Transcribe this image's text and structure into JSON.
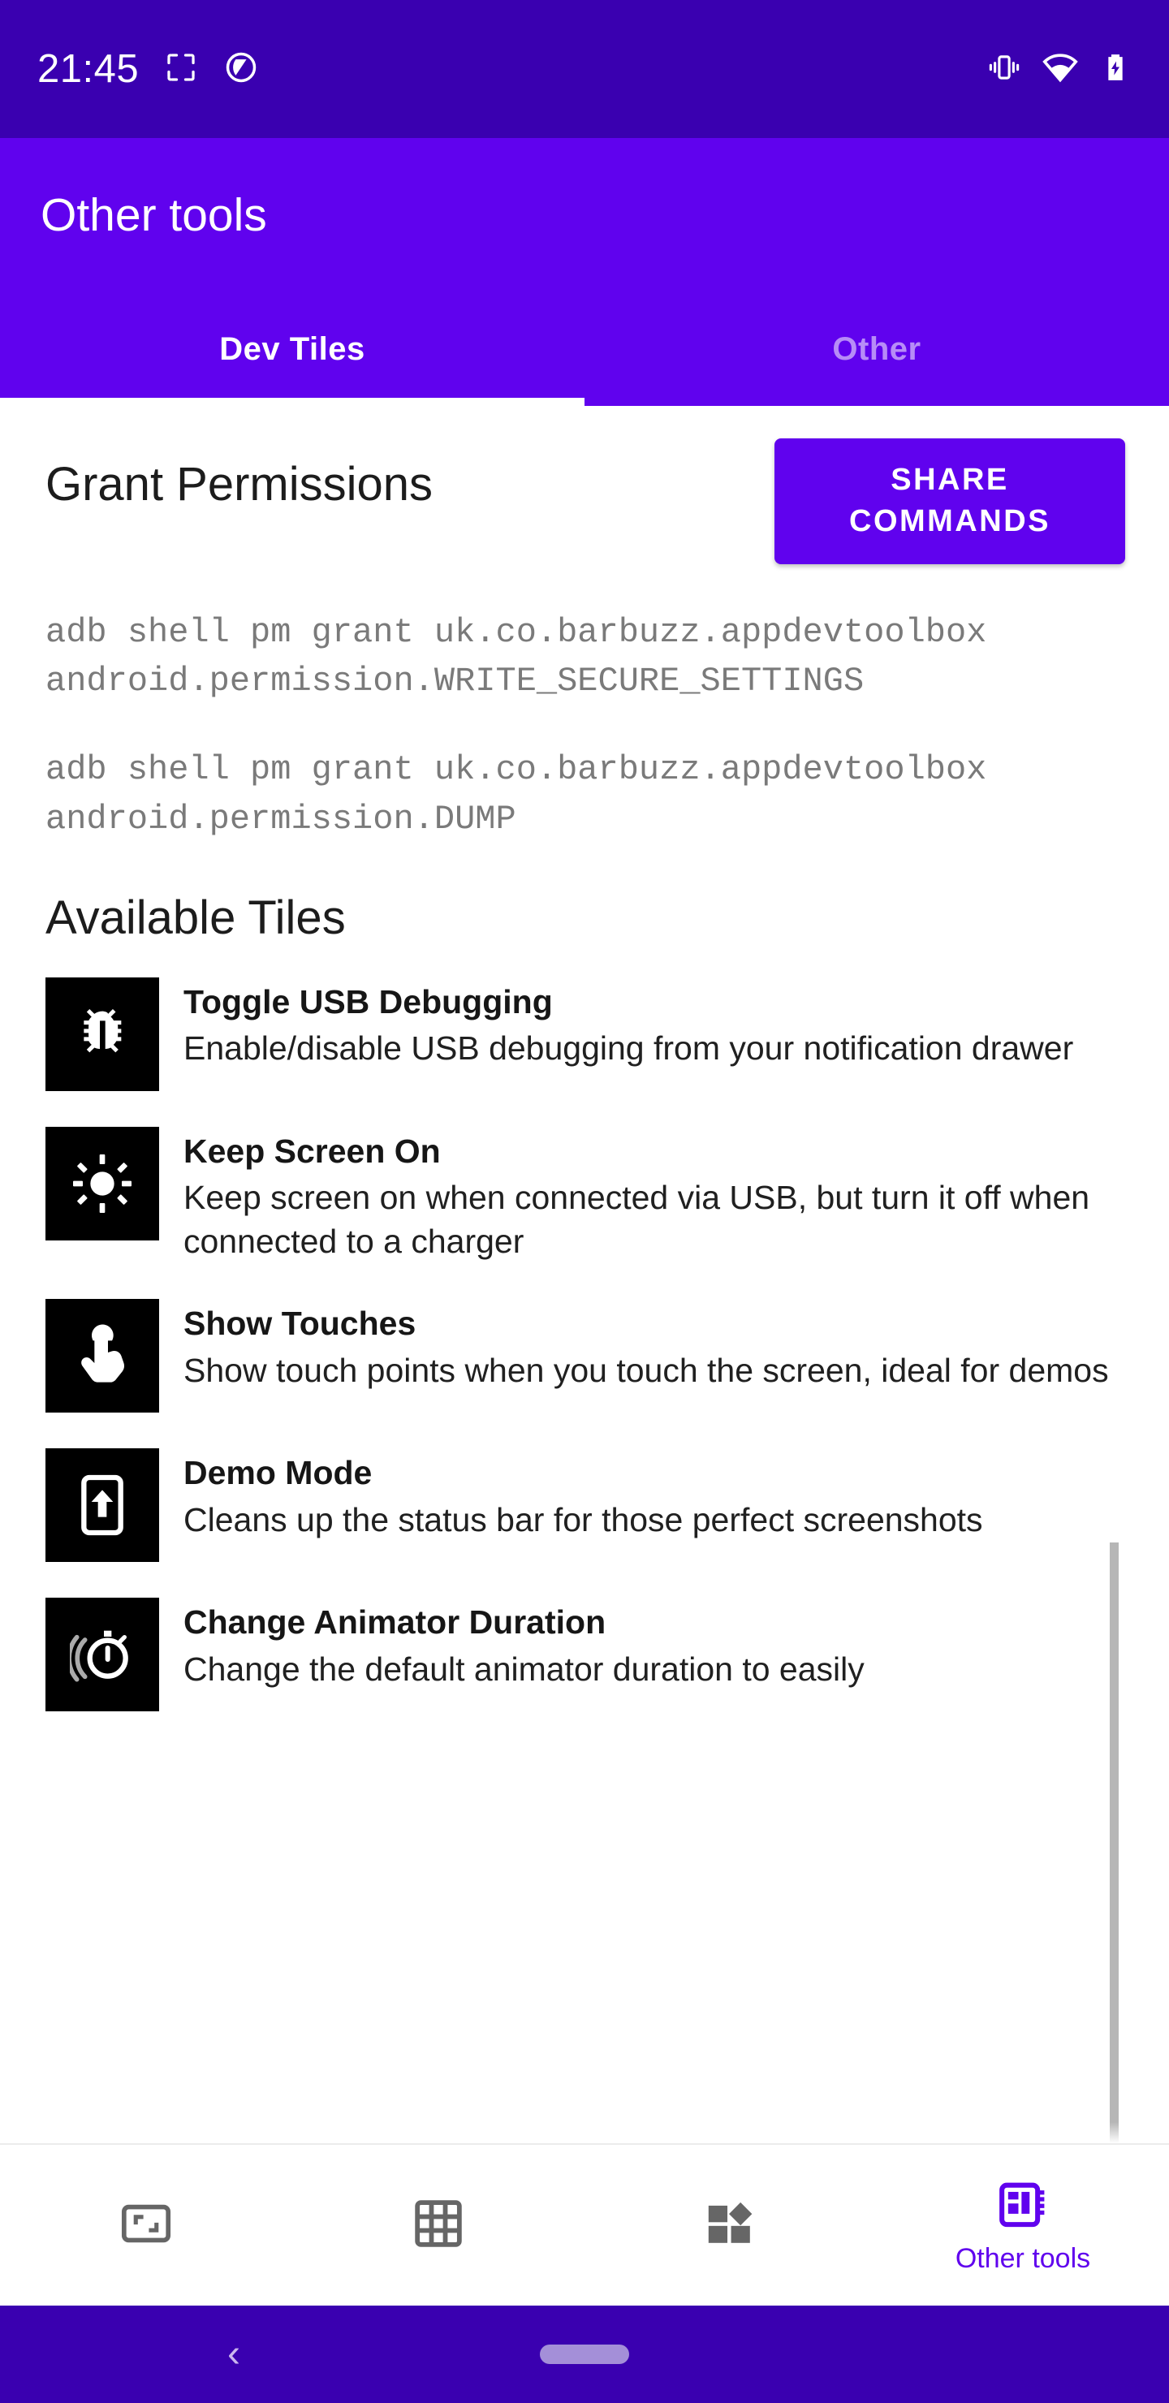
{
  "status_bar": {
    "clock": "21:45",
    "left_icons": [
      "screenshot-icon",
      "circle-slash-icon"
    ],
    "right_icons": [
      "vibrate-icon",
      "wifi-icon",
      "battery-charging-icon"
    ],
    "background_color": "#3a00b0"
  },
  "app_bar": {
    "title": "Other tools",
    "background_color": "#6002ee"
  },
  "tabs": {
    "items": [
      {
        "label": "Dev Tiles",
        "active": true
      },
      {
        "label": "Other",
        "active": false
      }
    ]
  },
  "permissions": {
    "heading": "Grant Permissions",
    "share_button_label": "SHARE COMMANDS",
    "commands": [
      "adb shell pm grant uk.co.barbuzz.appdevtoolbox android.permission.WRITE_SECURE_SETTINGS",
      "adb shell pm grant uk.co.barbuzz.appdevtoolbox android.permission.DUMP"
    ]
  },
  "available_tiles": {
    "heading": "Available Tiles",
    "items": [
      {
        "icon": "bug-icon",
        "name": "Toggle USB Debugging",
        "description": "Enable/disable USB debugging from your notification drawer"
      },
      {
        "icon": "brightness-sun-icon",
        "name": "Keep Screen On",
        "description": "Keep screen on when connected via USB, but turn it off when connected to a charger"
      },
      {
        "icon": "touch-pointer-icon",
        "name": "Show Touches",
        "description": "Show touch points when you touch the screen, ideal for demos"
      },
      {
        "icon": "phone-upload-icon",
        "name": "Demo Mode",
        "description": "Cleans up the status bar for those perfect screenshots"
      },
      {
        "icon": "stopwatch-icon",
        "name": "Change Animator Duration",
        "description": "Change the default animator duration to easily"
      }
    ]
  },
  "bottom_nav": {
    "items": [
      {
        "icon": "aspect-ratio-icon",
        "label": "",
        "active": false
      },
      {
        "icon": "grid-icon",
        "label": "",
        "active": false
      },
      {
        "icon": "dashboard-icon",
        "label": "",
        "active": false
      },
      {
        "icon": "developer-board-icon",
        "label": "Other tools",
        "active": true
      }
    ],
    "active_color": "#6002ee",
    "inactive_color": "#666666"
  },
  "gesture_bar": {
    "back_glyph": "‹",
    "background_color": "#3a00b0"
  }
}
